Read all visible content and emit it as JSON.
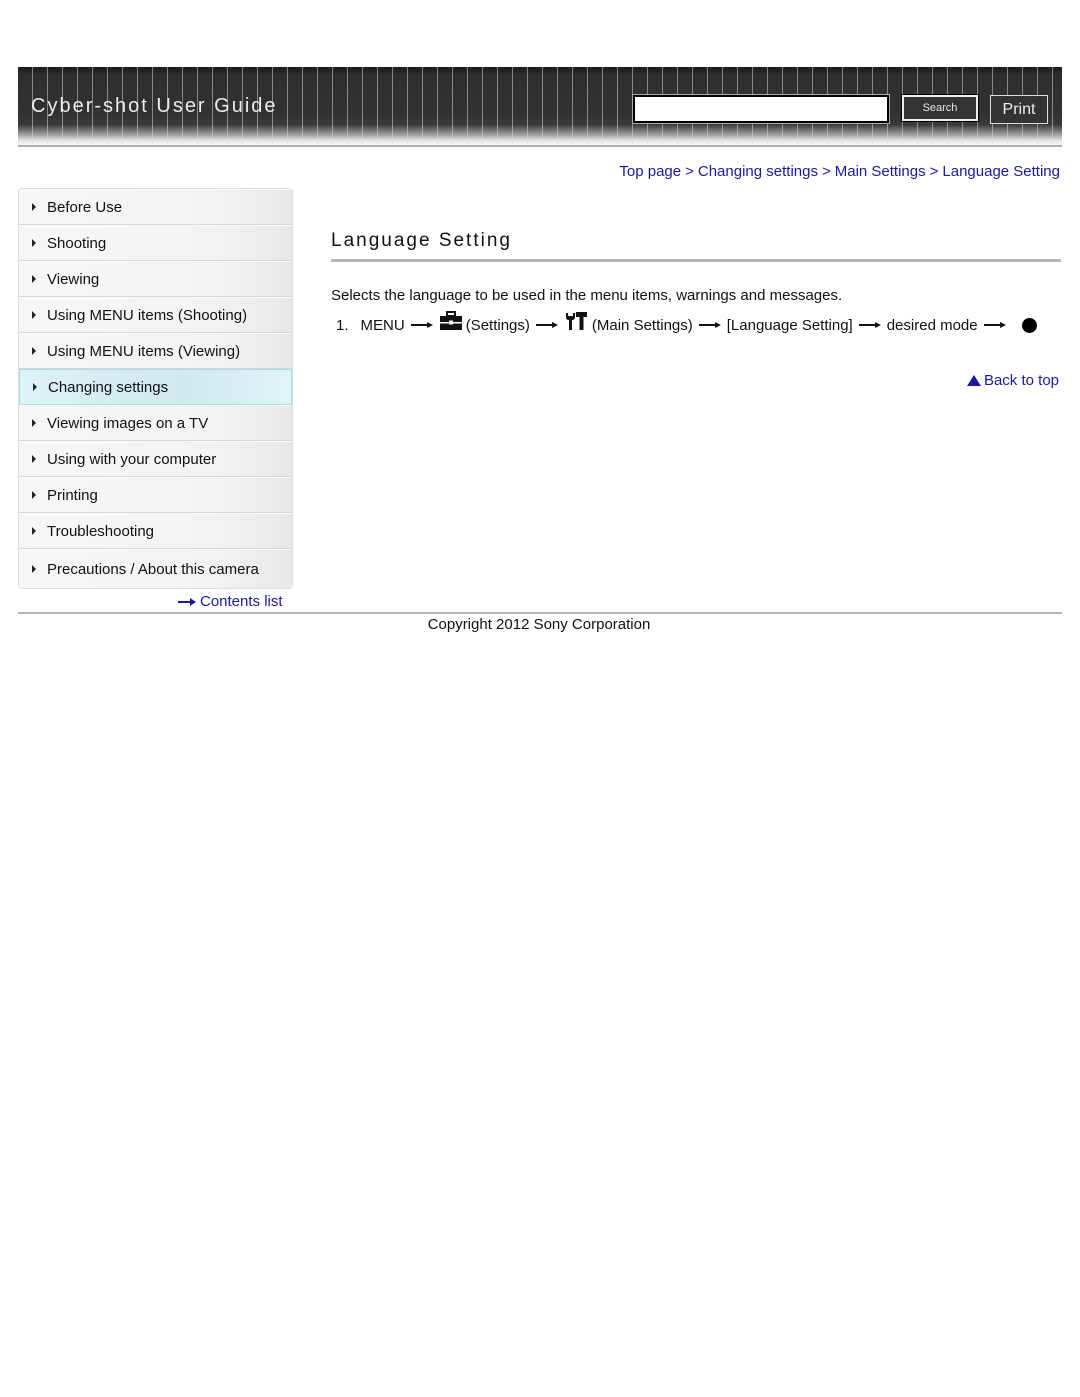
{
  "header": {
    "title": "Cyber-shot User Guide",
    "search": {
      "value": "",
      "placeholder": ""
    },
    "search_button": "Search",
    "print_button": "Print"
  },
  "breadcrumb": [
    {
      "label": "Top page"
    },
    {
      "label": "Changing settings"
    },
    {
      "label": "Main Settings"
    },
    {
      "label": "Language Setting"
    }
  ],
  "breadcrumb_separator": ">",
  "sidebar": {
    "items": [
      {
        "label": "Before Use",
        "active": false
      },
      {
        "label": "Shooting",
        "active": false
      },
      {
        "label": "Viewing",
        "active": false
      },
      {
        "label": "Using MENU items (Shooting)",
        "active": false
      },
      {
        "label": "Using MENU items (Viewing)",
        "active": false
      },
      {
        "label": "Changing settings",
        "active": true
      },
      {
        "label": "Viewing images on a TV",
        "active": false
      },
      {
        "label": "Using with your computer",
        "active": false
      },
      {
        "label": "Printing",
        "active": false
      },
      {
        "label": "Troubleshooting",
        "active": false
      },
      {
        "label": "Precautions / About this camera",
        "active": false
      }
    ],
    "contents_link": "Contents list"
  },
  "main": {
    "title": "Language Setting",
    "description": "Selects the language to be used in the menu items, warnings and messages.",
    "step": {
      "number": "1.",
      "parts": {
        "menu": "MENU",
        "settings": "(Settings)",
        "main_settings": "(Main Settings)",
        "language_setting": "[Language Setting]",
        "desired_mode": "desired mode"
      },
      "icons": [
        "toolbox-settings-icon",
        "wrench-hammer-main-settings-icon",
        "center-button-dot-icon"
      ]
    },
    "back_to_top": "Back to top"
  },
  "footer": {
    "copyright": "Copyright 2012 Sony Corporation"
  },
  "colors": {
    "link": "#1a1aa0",
    "header_bg": "#323232",
    "active_nav": "#d6eff3",
    "rule": "#b4b4b4"
  }
}
